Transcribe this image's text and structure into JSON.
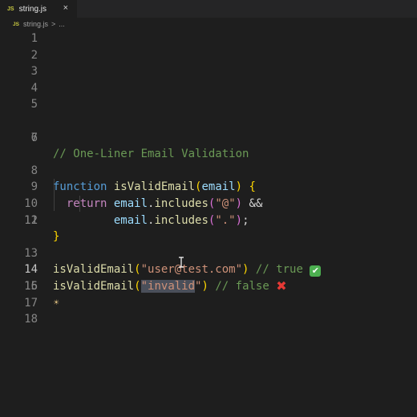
{
  "tab": {
    "icon_label": "JS",
    "filename": "string.js",
    "close_glyph": "×"
  },
  "breadcrumb": {
    "icon_label": "JS",
    "file": "string.js",
    "separator": ">",
    "more": "..."
  },
  "line_numbers": [
    "1",
    "2",
    "3",
    "4",
    "5",
    "6",
    "7",
    "8",
    "9",
    "10",
    "11",
    "12",
    "13",
    "14",
    "15",
    "16",
    "17",
    "18"
  ],
  "active_line": "14",
  "code": {
    "l6_comment": "// One-Liner Email Validation",
    "l8_function": "function",
    "l8_name": "isValidEmail",
    "l8_open_paren": "(",
    "l8_param": "email",
    "l8_close_paren": ")",
    "l8_brace": "{",
    "l9_return": "return",
    "l9_var": "email",
    "l9_dot": ".",
    "l9_method": "includes",
    "l9_open": "(",
    "l9_str": "\"@\"",
    "l9_close": ")",
    "l9_op": "&&",
    "l10_var": "email",
    "l10_dot": ".",
    "l10_method": "includes",
    "l10_open": "(",
    "l10_str": "\".\"",
    "l10_close": ")",
    "l10_semi": ";",
    "l11_brace": "}",
    "l13_call": "isValidEmail",
    "l13_open": "(",
    "l13_str": "\"user@test.com\"",
    "l13_close": ")",
    "l13_comment": "// true",
    "l14_call": "isValidEmail",
    "l14_open": "(",
    "l14_quote_open": "\"",
    "l14_selected": "invalid",
    "l14_quote_close": "\"",
    "l14_close": ")",
    "l14_comment": "// false",
    "l15_bulb": "☀"
  },
  "colors": {
    "background": "#1e1e1e",
    "keyword": "#569cd6",
    "function": "#dcdcaa",
    "variable": "#9cdcfe",
    "string": "#ce9178",
    "comment": "#6a9955",
    "bracket": "#ffd700"
  },
  "icons": [
    "js-file-icon",
    "close-icon",
    "check-mark-emoji",
    "cross-mark-emoji",
    "lightbulb-icon",
    "text-cursor-icon"
  ]
}
